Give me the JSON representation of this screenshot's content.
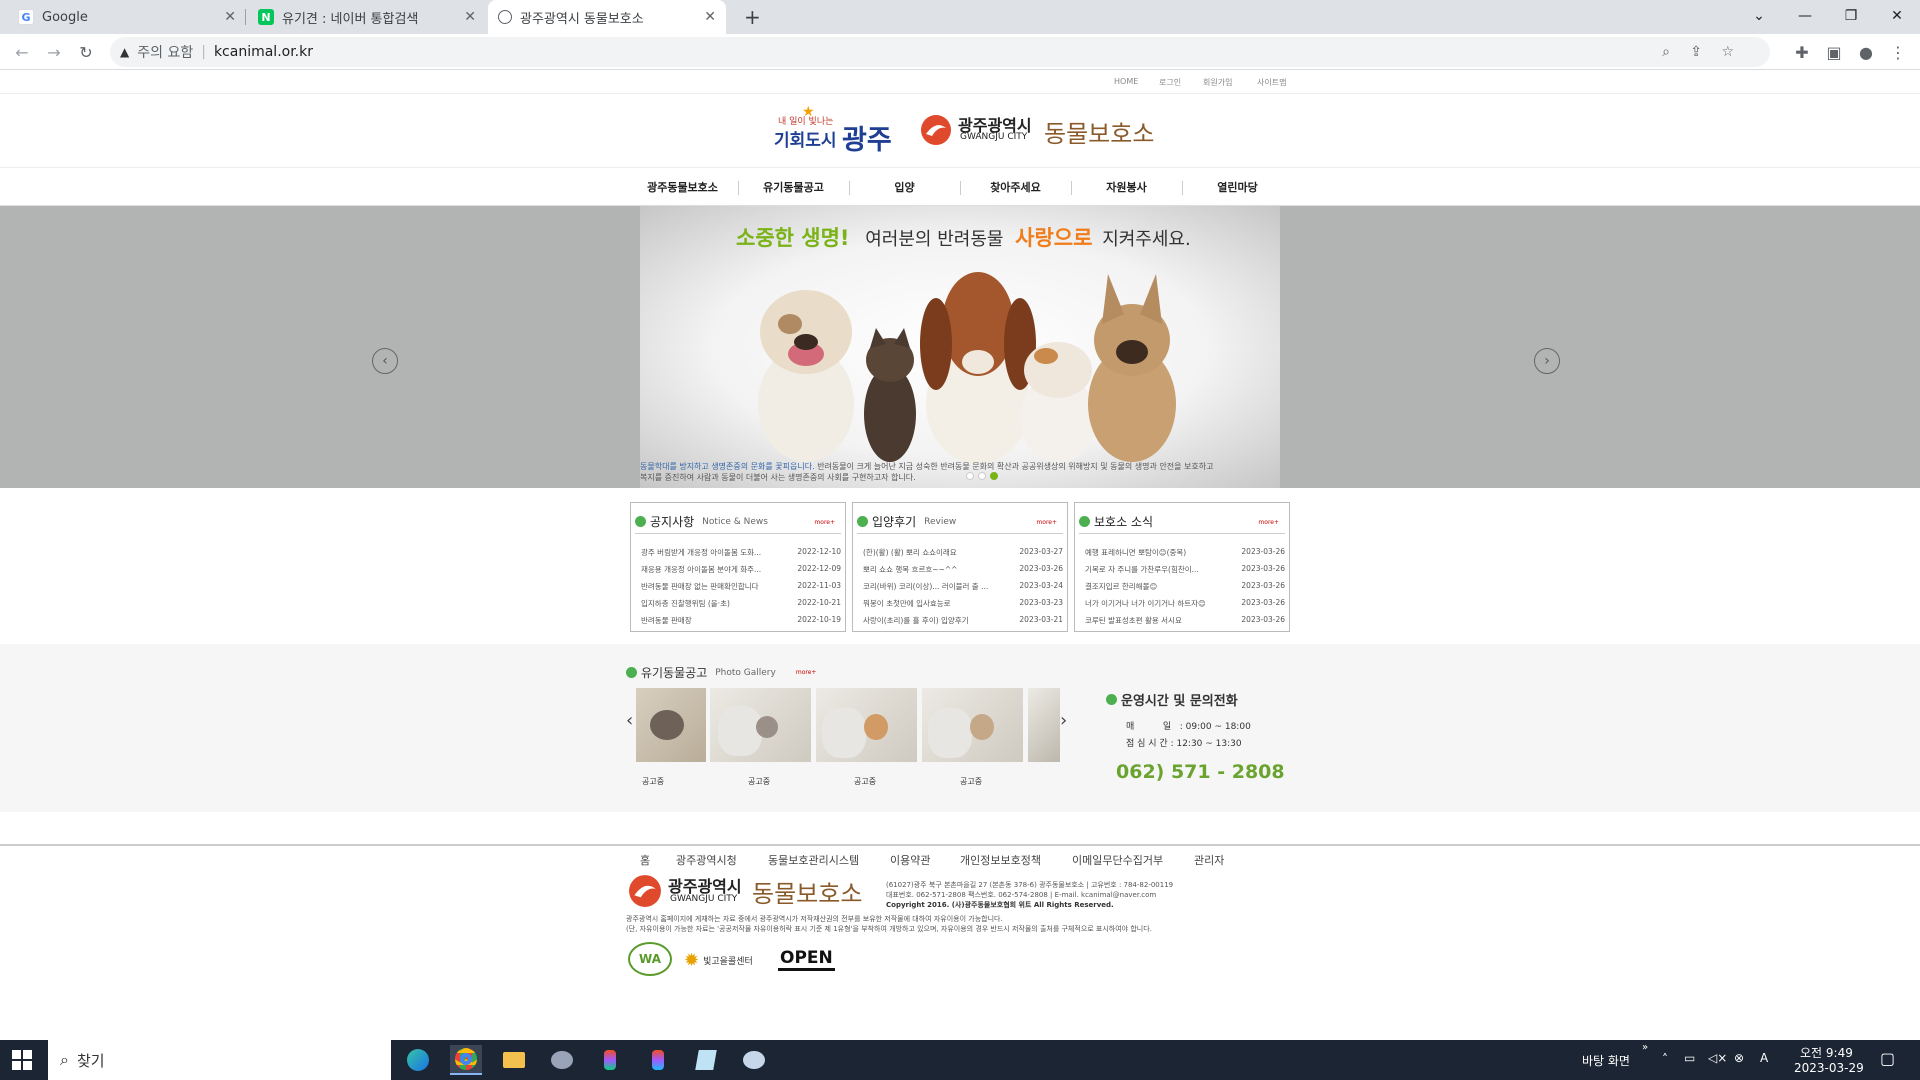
{
  "browser": {
    "tabs": [
      {
        "title": "Google",
        "icon": "google-icon"
      },
      {
        "title": "유기견 : 네이버 통합검색",
        "icon": "naver-icon"
      },
      {
        "title": "광주광역시 동물보호소",
        "icon": "globe-icon"
      }
    ],
    "new_tab": "+",
    "security_label": "주의 요함",
    "url": "kcanimal.or.kr"
  },
  "util_links": [
    "HOME",
    "로그인",
    "회원가입",
    "사이트맵"
  ],
  "logos": {
    "city_slogan_small": "내 일이 빛나는",
    "city_slogan_large": "기회도시",
    "city_name": "광주",
    "org_city_ko": "광주광역시",
    "org_city_en": "GWANGJU CITY",
    "org_name": "동물보호소"
  },
  "nav": [
    "광주동물보호소",
    "유기동물공고",
    "입양",
    "찾아주세요",
    "자원봉사",
    "열린마당"
  ],
  "hero": {
    "headline_green": "소중한 생명!",
    "headline_mid": "여러분의 반려동물",
    "headline_orange": "사랑으로",
    "headline_end": "지켜주세요.",
    "sub_blue": "동물학대를 방지하고 생명존중의 문화를 꽃피웁니다.",
    "sub_rest1": "반려동물이 크게 늘어난 지금 성숙한 반려동물 문화의 확산과 공공위생상의 위해방지 및 동물의 생명과 안전을 보호하고",
    "sub_rest2": "복지를 증진하여 사람과 동물이 더불어 사는 생명존중의 사회를 구현하고자 합니다.",
    "prev": "‹",
    "next": "›"
  },
  "boxes": [
    {
      "title": "공지사항",
      "en": "Notice & News",
      "more": "more+",
      "items": [
        {
          "t": "광주 버림받게 개응정 아이돌봄 도화...",
          "d": "2022-12-10"
        },
        {
          "t": "재응용 개응정 아이돌봄 분야게 화주...",
          "d": "2022-12-09"
        },
        {
          "t": "반려동물 판매장 없는 판매확인합니다",
          "d": "2022-11-03"
        },
        {
          "t": "입지하층 진찰행위팀 (을·초)",
          "d": "2022-10-21"
        },
        {
          "t": "반려동물 판매장",
          "d": "2022-10-19"
        }
      ]
    },
    {
      "title": "입양후기",
      "en": "Review",
      "more": "more+",
      "items": [
        {
          "t": "(한)(활) (활) 뽀리 쇼쇼이래요",
          "d": "2023-03-27"
        },
        {
          "t": "뽀리 쇼쇼 행복 흐르흐~~^^",
          "d": "2023-03-26"
        },
        {
          "t": "코리(바위) 코리(이상)... 러이블러 출 ...",
          "d": "2023-03-24"
        },
        {
          "t": "뭐봉이 초첫만에 입사효능로",
          "d": "2023-03-23"
        },
        {
          "t": "사랑이(초리)를 흘 후이) 입양후기",
          "d": "2023-03-21"
        }
      ]
    },
    {
      "title": "보호소 소식",
      "en": "",
      "more": "more+",
      "items": [
        {
          "t": "예행 표레하니면 뽀탐이😊(중복)",
          "d": "2023-03-26"
        },
        {
          "t": "기복로 자 주니를 가찬루우(힘찬이...",
          "d": "2023-03-26"
        },
        {
          "t": "결조지입르 한리해볼😊",
          "d": "2023-03-26"
        },
        {
          "t": "너가 이기거나 너가 이기거나 하트자😊",
          "d": "2023-03-26"
        },
        {
          "t": "코루틴 발표성초편 활용 서시요",
          "d": "2023-03-26"
        }
      ]
    }
  ],
  "gallery": {
    "title": "유기동물공고",
    "en": "Photo Gallery",
    "more": "more+",
    "captions": [
      "공고중",
      "공고중",
      "공고중",
      "공고중"
    ],
    "prev": "‹",
    "next": "›"
  },
  "hours": {
    "title": "운영시간 및 문의전화",
    "row1_label": "매          일",
    "row1_value": ": 09:00 ~ 18:00",
    "row2_label": "점 심 시 간",
    "row2_value": ": 12:30 ~ 13:30",
    "phone": "062) 571 - 2808"
  },
  "footer": {
    "links": [
      "홈",
      "광주광역시청",
      "동물보호관리시스템",
      "이용약관",
      "개인정보보호정책",
      "이메일무단수집거부",
      "관리자"
    ],
    "addr1": "(61027)광주 북구 본촌마을길 27 (본촌동 378-6) 광주동물보호소 | 고유번호 : 784-82-00119",
    "addr2": "대표번호. 062-571-2808 팩스번호. 062-574-2808 | E-mail. kcanimal@naver.com",
    "copyright": "Copyright 2016. (사)광주동물보호협회 위트 All Rights Reserved.",
    "notice1": "광주광역시 홈페이지에 게재하는 자료 중에서 광주광역시가 저작재산권의 전부를 보유한 저작물에 대하여 자유이용이 가능합니다.",
    "notice2": "(단, 자유이용이 가능한 자료는 '공공저작물 자유이용허락 표시 기준 제 1유형'을 부착하여 개방하고 있으며, 자유이용의 경우 반드시 저작물의 출처를 구체적으로 표시하여야 합니다.",
    "badge1": "WA",
    "badge2": "빛고을콜센터",
    "badge3": "OPEN"
  },
  "taskbar": {
    "search_placeholder": "찾기",
    "desktop_label": "바탕 화면",
    "time": "오전 9:49",
    "date": "2023-03-29",
    "ime": "A"
  },
  "colors": {
    "green": "#7ab317",
    "orange": "#f07c1a",
    "brand_red": "#e04a2c",
    "phone_green": "#6aa42f",
    "notice_dot": "#4caf50"
  }
}
